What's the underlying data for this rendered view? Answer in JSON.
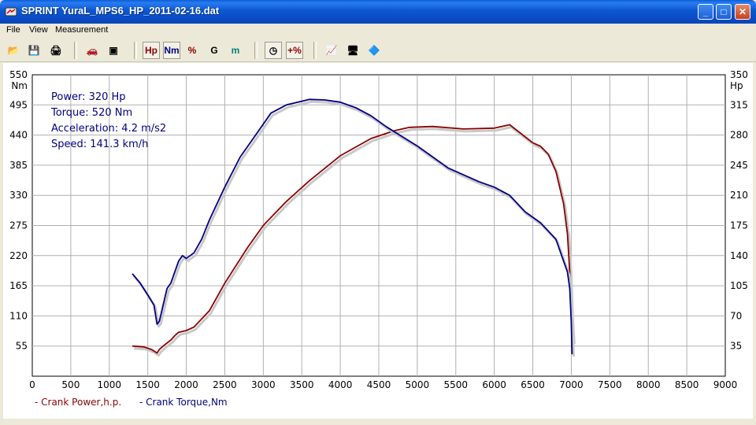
{
  "window": {
    "title": "SPRINT  YuraL_MPS6_HP_2011-02-16.dat",
    "buttons": [
      "_",
      "□",
      "✕"
    ]
  },
  "menu": [
    "File",
    "View",
    "Measurement"
  ],
  "toolbar": {
    "items": [
      {
        "name": "open-icon",
        "glyph": "📂"
      },
      {
        "name": "save-icon",
        "glyph": "💾"
      },
      {
        "name": "print-icon",
        "glyph": "🖨"
      },
      {
        "name": "car-icon",
        "glyph": "🚗"
      },
      {
        "name": "image-icon",
        "glyph": "▣"
      },
      {
        "name": "hp-button",
        "label": "Hp",
        "color": "#8b0000",
        "pressed": true
      },
      {
        "name": "nm-button",
        "label": "Nm",
        "color": "#000080",
        "pressed": true
      },
      {
        "name": "percent-button",
        "label": "%",
        "color": "#8b0000"
      },
      {
        "name": "g-button",
        "label": "G",
        "color": "#000"
      },
      {
        "name": "m-button",
        "label": "m",
        "color": "#008080"
      },
      {
        "name": "gauge-icon",
        "glyph": "◷",
        "pressed": true
      },
      {
        "name": "plus-percent-button",
        "label": "+%",
        "color": "#8b0000",
        "pressed": true
      },
      {
        "name": "chart-icon",
        "glyph": "📈"
      },
      {
        "name": "screen-icon",
        "glyph": "🖥"
      },
      {
        "name": "export-icon",
        "glyph": "🔷"
      }
    ]
  },
  "info": {
    "power": "Power: 320 Hp",
    "torque": "Torque: 520 Nm",
    "acceleration": "Acceleration: 4.2 m/s2",
    "speed": "Speed: 141.3 km/h"
  },
  "chart_data": {
    "type": "line",
    "x_ticks": [
      0,
      500,
      1000,
      1500,
      2000,
      2500,
      3000,
      3500,
      4000,
      4500,
      5000,
      5500,
      6000,
      6500,
      7000,
      7500,
      8000,
      8500,
      9000
    ],
    "xlim": [
      0,
      9000
    ],
    "y_left": {
      "unit": "Nm",
      "ticks": [
        55,
        110,
        165,
        220,
        275,
        330,
        385,
        440,
        495,
        550
      ],
      "ylim": [
        0,
        550
      ]
    },
    "y_right": {
      "unit": "Hp",
      "ticks": [
        35,
        70,
        105,
        140,
        175,
        210,
        245,
        280,
        315,
        350
      ],
      "ylim": [
        0,
        350
      ]
    },
    "grid": true,
    "legend_position": "bottom-left",
    "series": [
      {
        "name": "- Crank Power,h.p.",
        "axis": "right",
        "color": "#8b0000",
        "x": [
          1300,
          1450,
          1550,
          1620,
          1650,
          1700,
          1800,
          1850,
          1900,
          2000,
          2100,
          2300,
          2500,
          2800,
          3000,
          3300,
          3600,
          4000,
          4400,
          4700,
          4900,
          5200,
          5600,
          6000,
          6200,
          6500,
          6600,
          6700,
          6800,
          6900,
          6950,
          6980,
          7000,
          7020
        ],
        "y": [
          35,
          34,
          31,
          27,
          31,
          35,
          42,
          47,
          51,
          53,
          57,
          76,
          108,
          150,
          175,
          203,
          227,
          256,
          276,
          285,
          289,
          290,
          287,
          288,
          292,
          271,
          267,
          258,
          238,
          200,
          165,
          120,
          70,
          40
        ]
      },
      {
        "name": "- Crank Torque,Nm",
        "axis": "left",
        "color": "#000080",
        "x": [
          1300,
          1400,
          1500,
          1580,
          1620,
          1650,
          1700,
          1750,
          1800,
          1900,
          1950,
          2000,
          2100,
          2200,
          2300,
          2500,
          2700,
          2900,
          3100,
          3300,
          3600,
          3800,
          4000,
          4200,
          4400,
          4600,
          5000,
          5400,
          5800,
          6000,
          6200,
          6400,
          6600,
          6800,
          6900,
          6950,
          6980,
          7000,
          7010
        ],
        "y": [
          187,
          170,
          148,
          130,
          95,
          100,
          130,
          160,
          170,
          210,
          220,
          215,
          225,
          250,
          285,
          345,
          400,
          440,
          480,
          495,
          505,
          504,
          500,
          490,
          475,
          455,
          420,
          380,
          355,
          345,
          330,
          300,
          280,
          250,
          210,
          190,
          160,
          100,
          40
        ]
      }
    ]
  }
}
